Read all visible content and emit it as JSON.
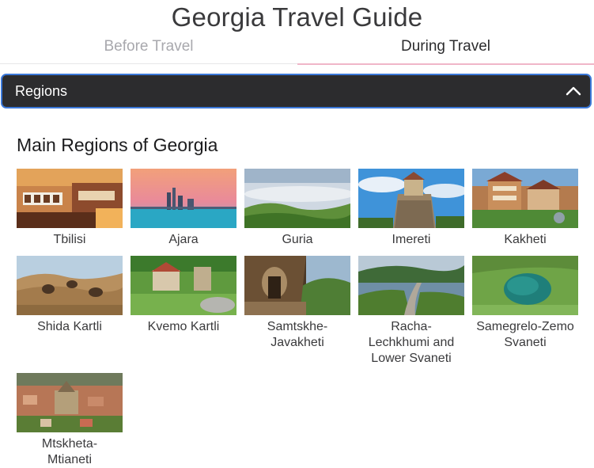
{
  "app": {
    "title": "Georgia Travel Guide"
  },
  "tabs": [
    {
      "label": "Before Travel",
      "active": false
    },
    {
      "label": "During Travel",
      "active": true
    }
  ],
  "accordion": {
    "label": "Regions",
    "expanded": true,
    "icon": "chevron-up-icon"
  },
  "section": {
    "title": "Main Regions of Georgia"
  },
  "regions": [
    {
      "label": "Tbilisi"
    },
    {
      "label": "Ajara"
    },
    {
      "label": "Guria"
    },
    {
      "label": "Imereti"
    },
    {
      "label": "Kakheti"
    },
    {
      "label": "Shida Kartli"
    },
    {
      "label": "Kvemo Kartli"
    },
    {
      "label": "Samtskhe-Javakheti",
      "lines": [
        "Samtskhe-",
        "Javakheti"
      ]
    },
    {
      "label": "Racha-Lechkhumi and Lower Svaneti",
      "lines": [
        "Racha-",
        "Lechkhumi and",
        "Lower Svaneti"
      ]
    },
    {
      "label": "Samegrelo-Zemo Svaneti",
      "lines": [
        "Samegrelo-Zemo",
        "Svaneti"
      ]
    },
    {
      "label": "Mtskheta-Mtianeti",
      "lines": [
        "Mtskheta-",
        "Mtianeti"
      ]
    }
  ],
  "colors": {
    "accordion_bg": "#2c2c2e",
    "accordion_border": "#3b78d8",
    "tab_indicator": "#f0b6c8"
  }
}
